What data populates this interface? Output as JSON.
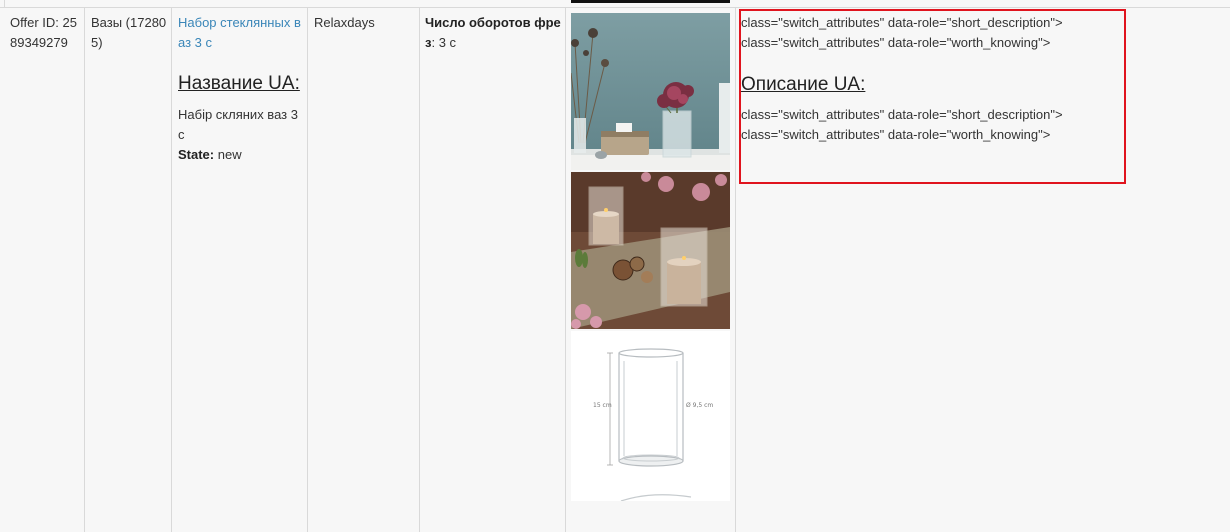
{
  "row": {
    "offer_id": "Offer ID: 2589349279",
    "category": "Вазы (172805)",
    "product_link": "Набор стеклянных ваз 3 с",
    "name_ua_heading": "Название UA:",
    "name_ua_value": "Набір скляних ваз 3 с",
    "state_label": "State:",
    "state_value": "new",
    "brand": "Relaxdays",
    "attr_label": "Число оборотов фрез",
    "attr_value": ": 3 с",
    "description_lines_1": [
      "class=\"switch_attributes\" data-role=\"short_description\">",
      "class=\"switch_attributes\" data-role=\"worth_knowing\">"
    ],
    "description_ua_heading": "Описание UA:",
    "description_lines_2": [
      "class=\"switch_attributes\" data-role=\"short_description\">",
      "class=\"switch_attributes\" data-role=\"worth_knowing\">"
    ]
  },
  "images": {
    "dim_height": "15 cm",
    "dim_diameter": "Ø 9,5 cm"
  },
  "colors": {
    "highlight": "#e0141e",
    "link": "#3a86b8",
    "border": "#d9d9d9",
    "background": "#f7f7f7"
  }
}
